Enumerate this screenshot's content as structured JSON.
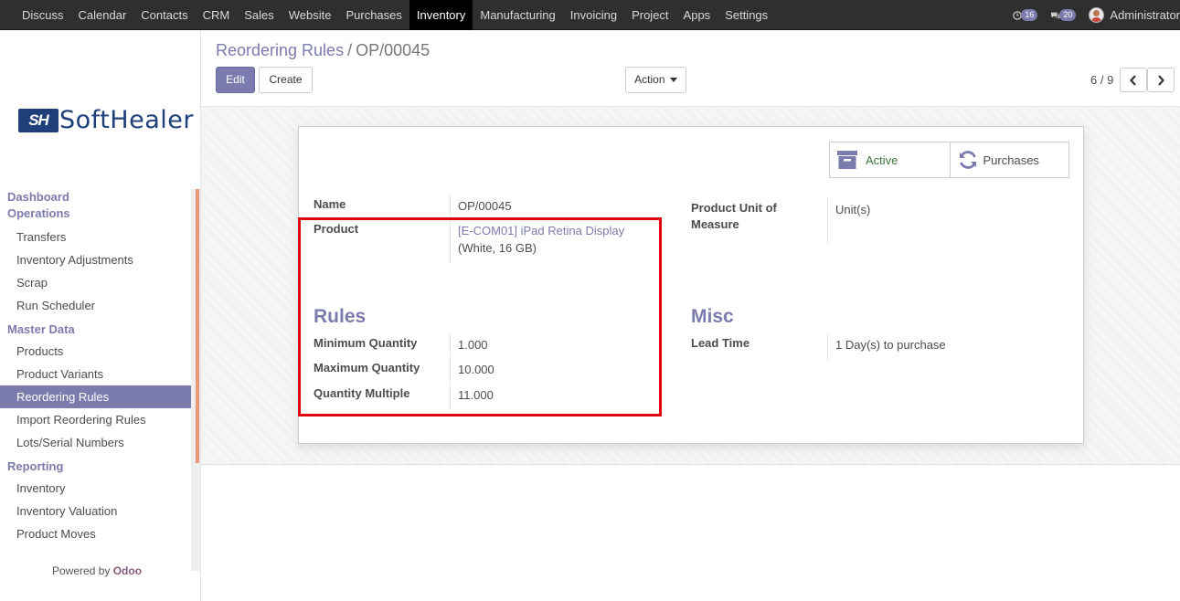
{
  "topbar": {
    "menu": [
      "Discuss",
      "Calendar",
      "Contacts",
      "CRM",
      "Sales",
      "Website",
      "Purchases",
      "Inventory",
      "Manufacturing",
      "Invoicing",
      "Project",
      "Apps",
      "Settings"
    ],
    "active_menu": "Inventory",
    "activity_count": "16",
    "message_count": "20",
    "user_name": "Administrator"
  },
  "sidebar": {
    "logo_mark": "SH",
    "logo_text": "SoftHealer",
    "sections": [
      {
        "header": "Dashboard",
        "items": []
      },
      {
        "header": "Operations",
        "items": [
          "Transfers",
          "Inventory Adjustments",
          "Scrap",
          "Run Scheduler"
        ]
      },
      {
        "header": "Master Data",
        "items": [
          "Products",
          "Product Variants",
          "Reordering Rules",
          "Import Reordering Rules",
          "Lots/Serial Numbers"
        ]
      },
      {
        "header": "Reporting",
        "items": [
          "Inventory",
          "Inventory Valuation",
          "Product Moves"
        ]
      }
    ],
    "selected_item": "Reordering Rules",
    "powered_by_prefix": "Powered by",
    "powered_by_brand": "Odoo"
  },
  "control_panel": {
    "breadcrumb_parent": "Reordering Rules",
    "breadcrumb_sep": "/",
    "breadcrumb_current": "OP/00045",
    "edit_label": "Edit",
    "create_label": "Create",
    "action_label": "Action",
    "pager_value": "6 / 9"
  },
  "form": {
    "smart_buttons": {
      "active_label": "Active",
      "purchases_label": "Purchases"
    },
    "name_label": "Name",
    "name_value": "OP/00045",
    "product_label": "Product",
    "product_link": "[E-COM01] iPad Retina Display",
    "product_variant": "(White, 16 GB)",
    "uom_label_1": "Product Unit of",
    "uom_label_2": "Measure",
    "uom_value": "Unit(s)",
    "rules_title": "Rules",
    "min_qty_label": "Minimum Quantity",
    "min_qty_value": "1.000",
    "max_qty_label": "Maximum Quantity",
    "max_qty_value": "10.000",
    "qty_multiple_label": "Quantity Multiple",
    "qty_multiple_value": "11.000",
    "misc_title": "Misc",
    "lead_time_label": "Lead Time",
    "lead_time_value": "1 Day(s) to purchase"
  },
  "colors": {
    "brand": "#7c7bad",
    "topbar": "#2f2f2f",
    "highlight": "#e2000f",
    "active_green": "#3c763d",
    "logo_blue": "#1f3f7a"
  }
}
